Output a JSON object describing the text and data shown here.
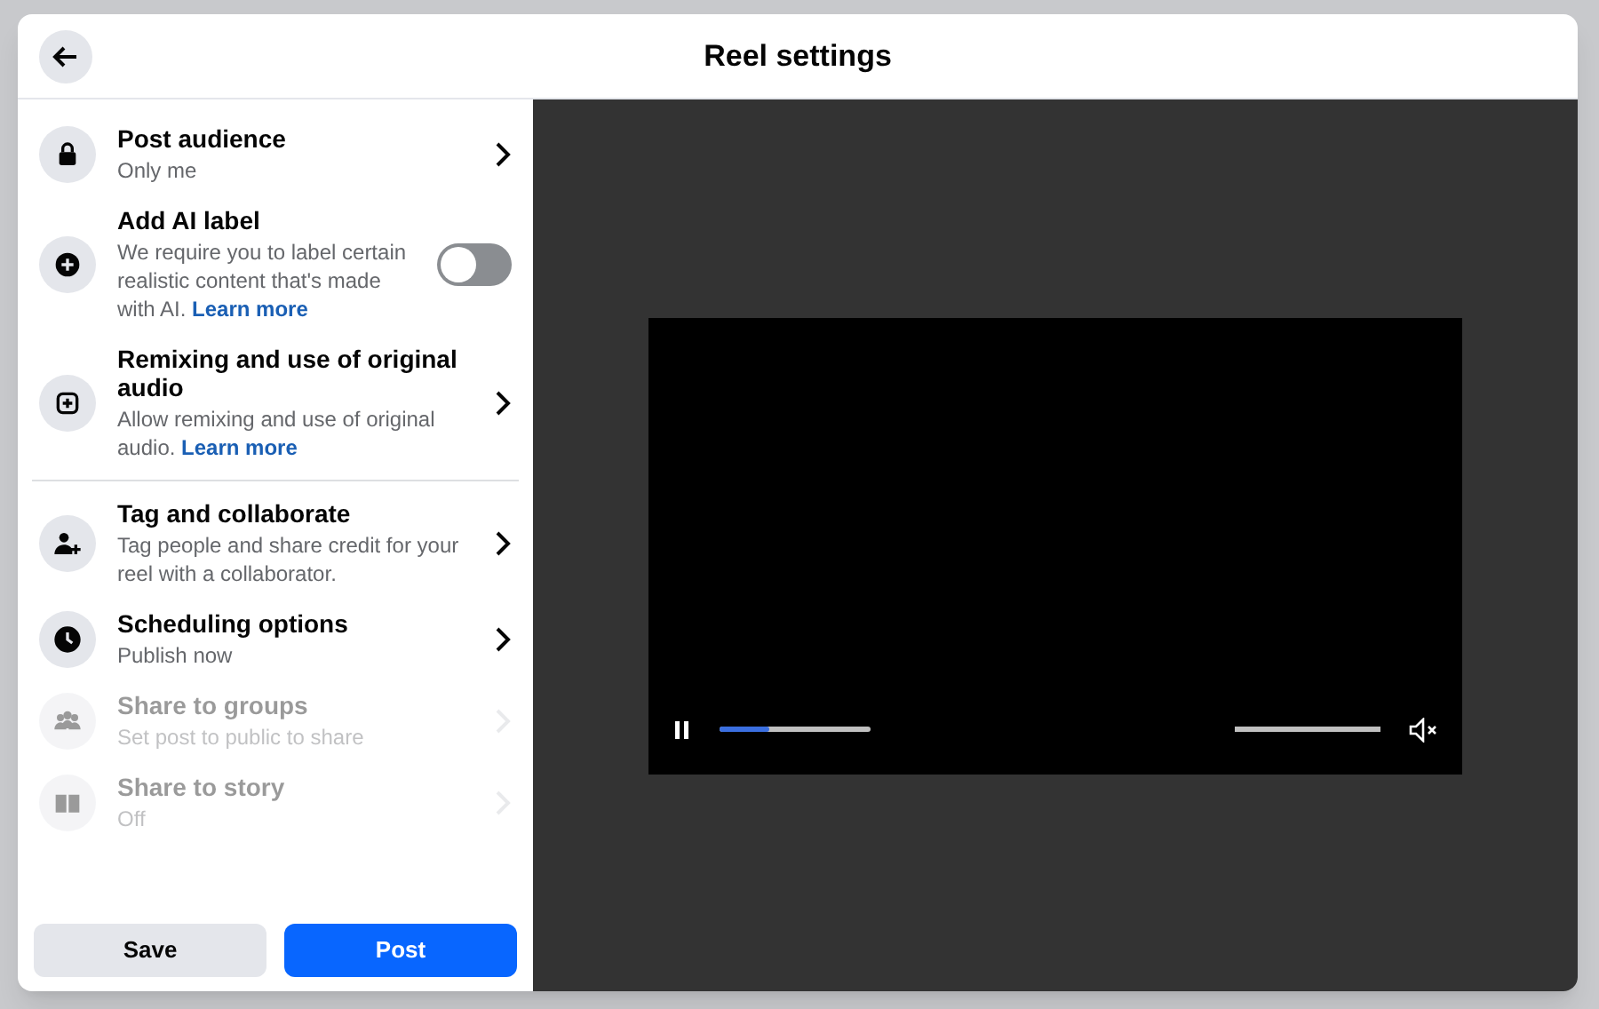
{
  "dialog": {
    "title": "Reel settings"
  },
  "settings": [
    {
      "kind": "chevron",
      "title": "Post audience",
      "description": "Only me",
      "disabled": false
    },
    {
      "kind": "toggle",
      "title": "Add AI label",
      "description": "We require you to label certain realistic content that's made with AI.",
      "link": "Learn more",
      "on": false,
      "disabled": false
    },
    {
      "kind": "chevron",
      "title": "Remixing and use of original audio",
      "description": "Allow remixing and use of original audio.",
      "link": "Learn more",
      "disabled": false
    },
    {
      "kind": "chevron",
      "title": "Tag and collaborate",
      "description": "Tag people and share credit for your reel with a collaborator.",
      "disabled": false,
      "divider_before": true
    },
    {
      "kind": "chevron",
      "title": "Scheduling options",
      "description": "Publish now",
      "disabled": false
    },
    {
      "kind": "chevron",
      "title": "Share to groups",
      "description": "Set post to public to share",
      "disabled": true
    },
    {
      "kind": "chevron",
      "title": "Share to story",
      "description": "Off",
      "disabled": true
    }
  ],
  "buttons": [
    {
      "label": "Save",
      "kind": "secondary"
    },
    {
      "label": "Post",
      "kind": "primary"
    }
  ],
  "player": {
    "playing": true,
    "progress": {
      "level": 0.33
    },
    "volume": {
      "level": 1
    },
    "muted": true
  }
}
